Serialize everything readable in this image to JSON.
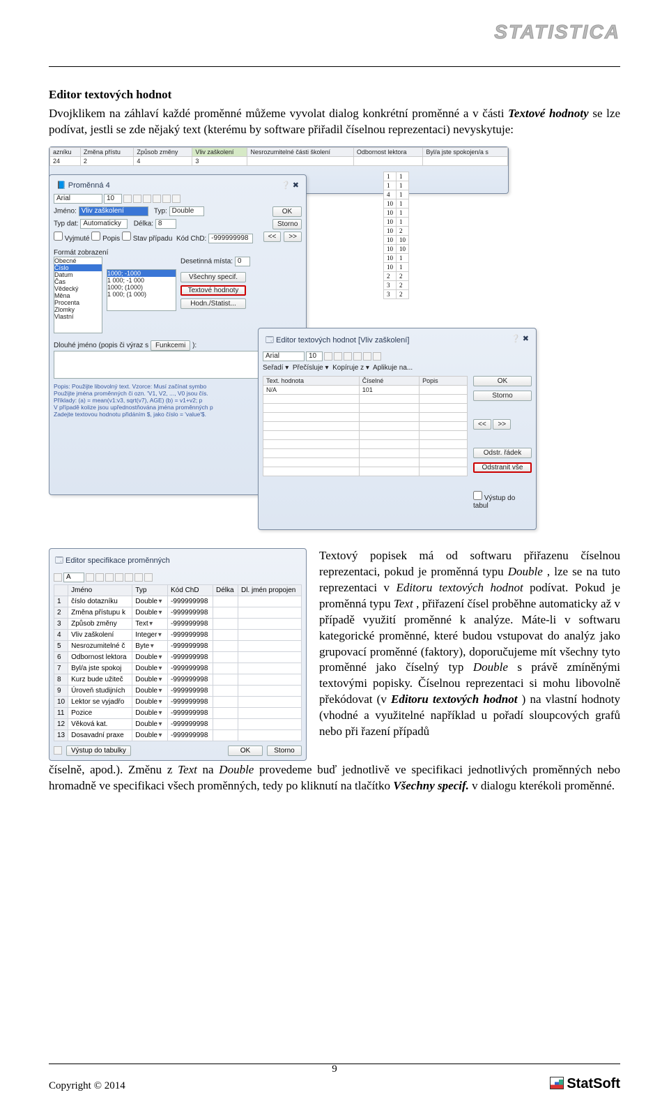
{
  "header": {
    "brand": "STATISTICA"
  },
  "section": {
    "title": "Editor textových hodnot",
    "intro_parts": {
      "a": "Dvojklikem na záhlaví každé proměnné můžeme vyvolat dialog konkrétní proměnné a v části ",
      "b": "Textové hodnoty",
      "c": " se lze podívat, jestli se zde nějaký text (kterému by software přiřadil číselnou reprezentaci) nevyskytuje:"
    }
  },
  "shot1": {
    "grid_headers": [
      "azníku",
      "Změna přístu",
      "Způsob změny",
      "Vliv zaškolení",
      "Nesrozumitelné části školení",
      "Odbornost lektora",
      "Byl/a jste spokojen/a s"
    ],
    "grid_row": [
      "24",
      "2",
      "4",
      "3",
      "",
      "",
      ""
    ],
    "side_col1": [
      "1",
      "1",
      "4",
      "10",
      "10",
      "10",
      "10",
      "10",
      "10",
      "10",
      "10",
      "2",
      "3",
      "3"
    ],
    "side_col2": [
      "1",
      "1",
      "1",
      "1",
      "1",
      "1",
      "2",
      "10",
      "10",
      "1",
      "1",
      "2",
      "2",
      "2"
    ],
    "var_dialog": {
      "title": "Proměnná 4",
      "font": "Arial",
      "size": "10",
      "name_lbl": "Jméno:",
      "name_val": "Vliv zaškolení",
      "type_lbl": "Typ:",
      "type_val": "Double",
      "datatype_lbl": "Typ dat:",
      "datatype_val": "Automaticky",
      "len_lbl": "Délka:",
      "len_val": "8",
      "chk_vyjmute": "Vyjmuté",
      "chk_popis": "Popis",
      "chk_stav": "Stav případu",
      "kodchd_lbl": "Kód ChD:",
      "kodchd_val": "-999999998",
      "ok": "OK",
      "storno": "Storno",
      "nav_prev": "<<",
      "nav_next": ">>",
      "format_lbl": "Formát zobrazení",
      "fmt_items": [
        "Obecné",
        "Číslo",
        "Datum",
        "Čas",
        "Vědecký",
        "Měna",
        "Procenta",
        "Zlomky",
        "Vlastní"
      ],
      "fmt_examples": [
        "1000; -1000",
        "1 000; -1 000",
        "1000; (1000)",
        "1 000; (1 000)"
      ],
      "dec_lbl": "Desetinná místa:",
      "dec_val": "0",
      "btn_vsechny": "Všechny specif.",
      "btn_text": "Textové hodnoty",
      "btn_hodn": "Hodn./Statist...",
      "long_lbl": "Dlouhé jméno (popis či výraz s",
      "funkcemi": "Funkcemi",
      "hint": "Popis: Použijte libovolný text. Vzorce: Musí začínat symbo\nPoužijte jména proměnných či ozn. 'V1, V2, ..., V0 jsou čís.\nPříklady: (a) = mean(v1:v3, sqrt(v7), AGE) (b) = v1+v2; p\nV případě kolize jsou upřednostňována jména proměnných p\nZadejte textovou hodnotu přidáním $, jako číslo = 'value'$."
    },
    "text_editor": {
      "title": "Editor textových hodnot [Vliv zaškolení]",
      "font": "Arial",
      "size": "10",
      "menu": [
        "Seřadí ▾",
        "Přečísluje ▾",
        "Kopíruje z ▾",
        "Aplikuje na..."
      ],
      "cols": [
        "Text. hodnota",
        "Číselné",
        "Popis"
      ],
      "row": [
        "N/A",
        "101",
        ""
      ],
      "ok": "OK",
      "storno": "Storno",
      "nav_prev": "<<",
      "nav_next": ">>",
      "btn_odstr": "Odstr. řádek",
      "btn_odstrvs": "Odstranit vše",
      "chk_vystup": "Výstup do tabul"
    }
  },
  "shot2": {
    "title": "Editor specifikace proměnných",
    "font": "A",
    "cols": [
      "",
      "Jméno",
      "Typ",
      "Kód ChD",
      "Délka",
      "Dl. jmén propojen"
    ],
    "rows": [
      [
        "1",
        "číslo dotazníku",
        "Double",
        "-999999998",
        "",
        ""
      ],
      [
        "2",
        "Změna přístupu k",
        "Double",
        "-999999998",
        "",
        ""
      ],
      [
        "3",
        "Způsob změny",
        "Text",
        "-999999998",
        "",
        ""
      ],
      [
        "4",
        "Vliv zaškolení",
        "Integer",
        "-999999998",
        "",
        ""
      ],
      [
        "5",
        "Nesrozumitelné č",
        "Byte",
        "-999999998",
        "",
        ""
      ],
      [
        "6",
        "Odbornost lektora",
        "Double",
        "-999999998",
        "",
        ""
      ],
      [
        "7",
        "Byl/a jste spokoj",
        "Double",
        "-999999998",
        "",
        ""
      ],
      [
        "8",
        "Kurz bude užiteč",
        "Double",
        "-999999998",
        "",
        ""
      ],
      [
        "9",
        "Úroveň studijních",
        "Double",
        "-999999998",
        "",
        ""
      ],
      [
        "10",
        "Lektor se vyjadřo",
        "Double",
        "-999999998",
        "",
        ""
      ],
      [
        "11",
        "Pozice",
        "Double",
        "-999999998",
        "",
        ""
      ],
      [
        "12",
        "Věková kat.",
        "Double",
        "-999999998",
        "",
        ""
      ],
      [
        "13",
        "Dosavadní praxe",
        "Double",
        "-999999998",
        "",
        ""
      ]
    ],
    "btn_vystup": "Výstup do tabulky",
    "ok": "OK",
    "storno": "Storno"
  },
  "para2": {
    "a": "Textový popisek má od softwaru přiřazenu číselnou reprezentaci, pokud je proměnná typu ",
    "b": "Double",
    "c": ", lze se na tuto reprezentaci v ",
    "d": "Editoru textových hodnot",
    "e": " podívat. Pokud je proměnná typu ",
    "f": "Text",
    "g": ", přiřazení čísel proběhne automaticky až v případě využití proměnné k analýze. Máte-li v softwaru kategorické proměnné, které budou vstupovat do analýz jako grupovací proměnné (faktory), doporučujeme mít všechny tyto proměnné jako číselný typ ",
    "h": "Double",
    "i": " s právě zmíněnými textovými popisky. Číselnou reprezentaci si mohu libovolně překódovat (v ",
    "j": "Editoru textových hodnot",
    "k": ") na vlastní hodnoty (vhodné a využitelné například u pořadí sloupcových grafů nebo při řazení případů"
  },
  "post": {
    "a": "číselně, apod.). Změnu z ",
    "b": "Text",
    "c": " na ",
    "d": "Double",
    "e": " provedeme buď jednotlivě ve specifikaci jednotlivých proměnných nebo hromadně ve specifikaci všech proměnných, tedy po kliknutí na tlačítko ",
    "f": "Všechny specif.",
    "g": " v dialogu kterékoli proměnné."
  },
  "footer": {
    "copyright": "Copyright © 2014",
    "page": "9",
    "brand": "StatSoft"
  }
}
